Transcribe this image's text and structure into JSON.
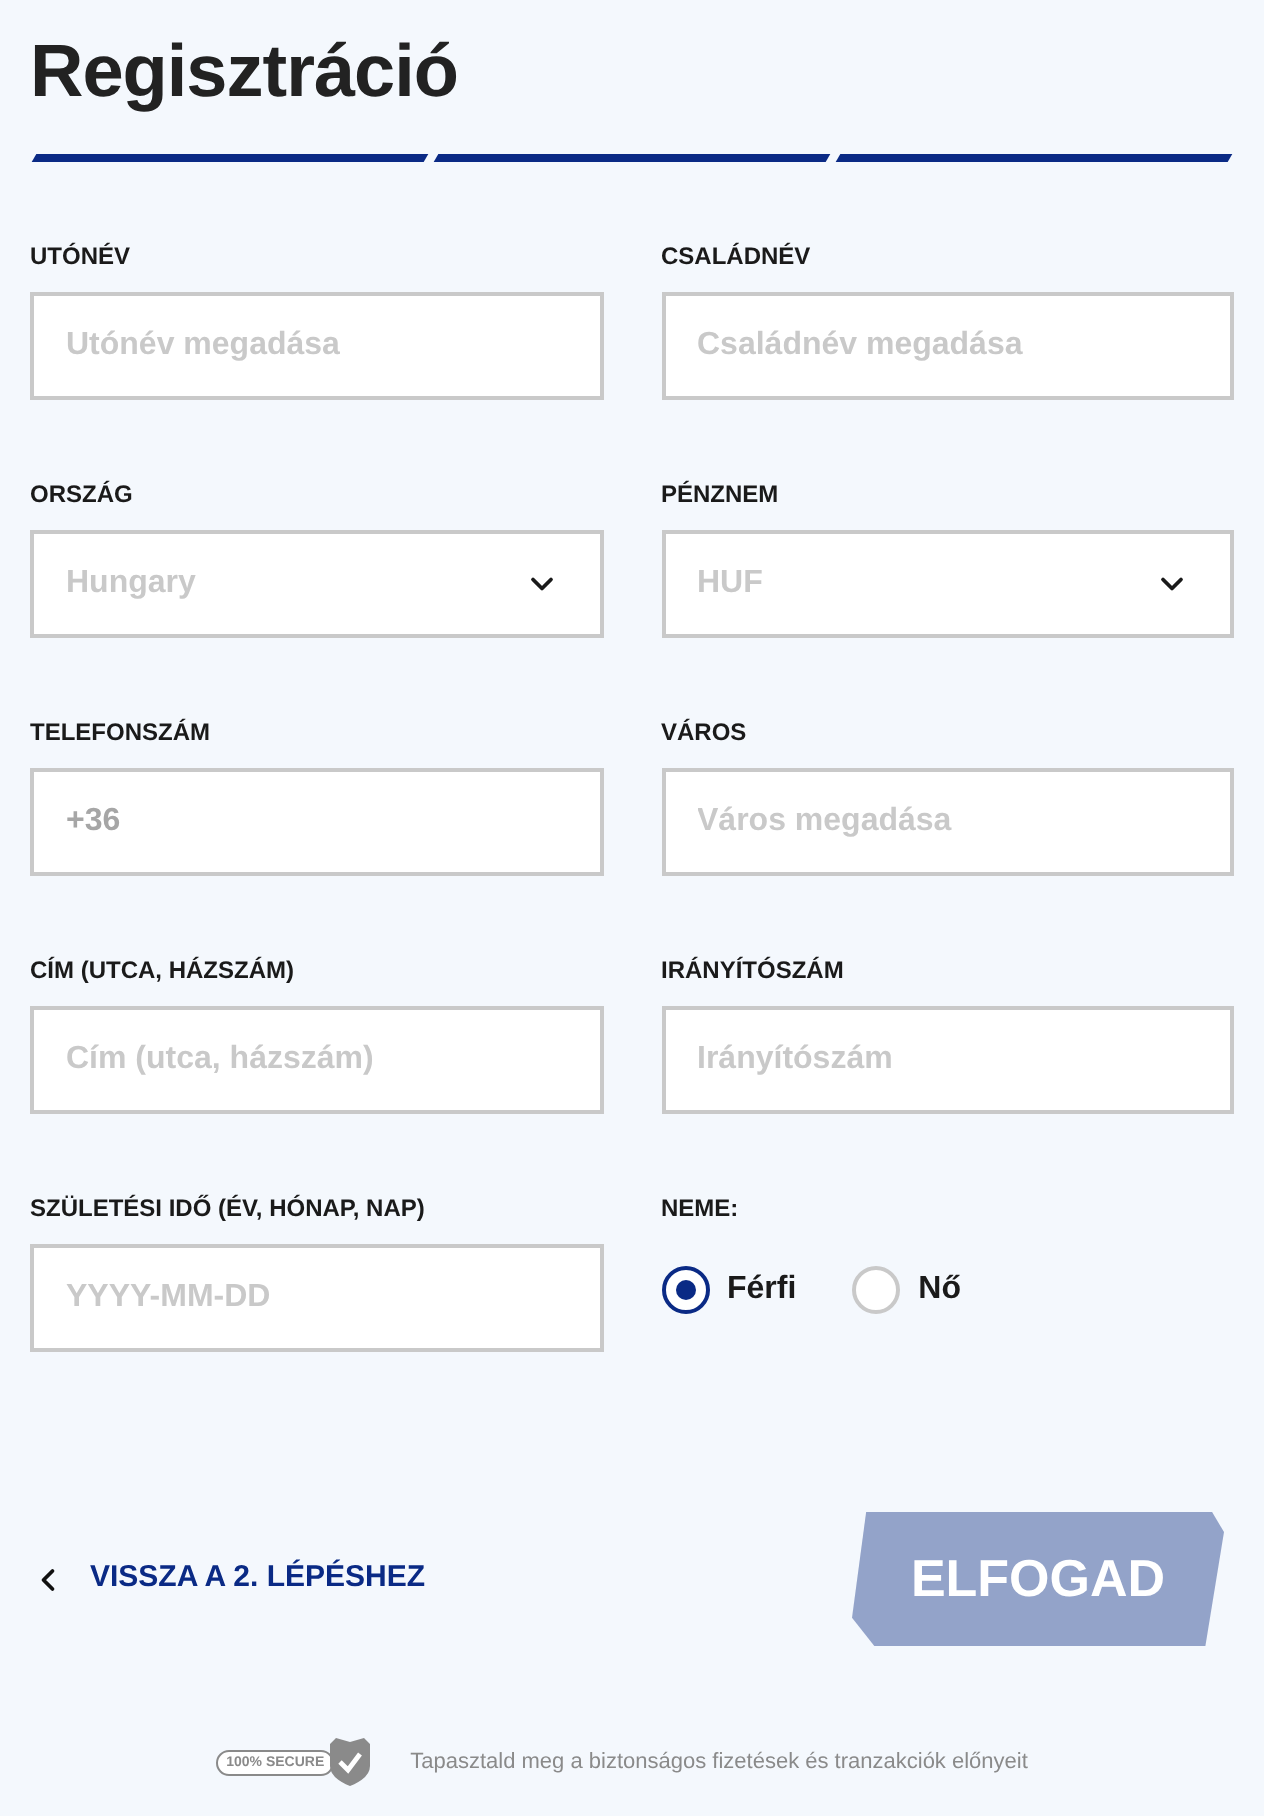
{
  "title": "Regisztráció",
  "steps": [
    {
      "done": true
    },
    {
      "done": true
    },
    {
      "done": true
    }
  ],
  "fields": [
    {
      "kind": "text",
      "label": "UTÓNÉV",
      "placeholder": "Utónév megadása"
    },
    {
      "kind": "text",
      "label": "CSALÁDNÉV",
      "placeholder": "Családnév megadása"
    },
    {
      "kind": "select",
      "label": "ORSZÁG",
      "value": "Hungary"
    },
    {
      "kind": "select",
      "label": "PÉNZNEM",
      "value": "HUF"
    },
    {
      "kind": "text",
      "label": "TELEFONSZÁM",
      "value": "+36"
    },
    {
      "kind": "text",
      "label": "VÁROS",
      "placeholder": "Város megadása"
    },
    {
      "kind": "text",
      "label": "CÍM (UTCA, HÁZSZÁM)",
      "placeholder": "Cím (utca, házszám)"
    },
    {
      "kind": "text",
      "label": "IRÁNYÍTÓSZÁM",
      "placeholder": "Irányítószám"
    },
    {
      "kind": "text",
      "label": "SZÜLETÉSI IDŐ (ÉV, HÓNAP, NAP)",
      "placeholder": "YYYY-MM-DD"
    },
    {
      "kind": "radio",
      "label": "NEME:",
      "options": [
        {
          "label": "Férfi",
          "selected": true
        },
        {
          "label": "Nő",
          "selected": false
        }
      ]
    }
  ],
  "back_link": "VISSZA A 2. LÉPÉSHEZ",
  "submit": {
    "label": "ELFOGAD",
    "disabled": true
  },
  "footer": {
    "badge": "100% SECURE",
    "text": "Tapasztald meg a biztonságos fizetések és tranzakciók előnyeit"
  }
}
